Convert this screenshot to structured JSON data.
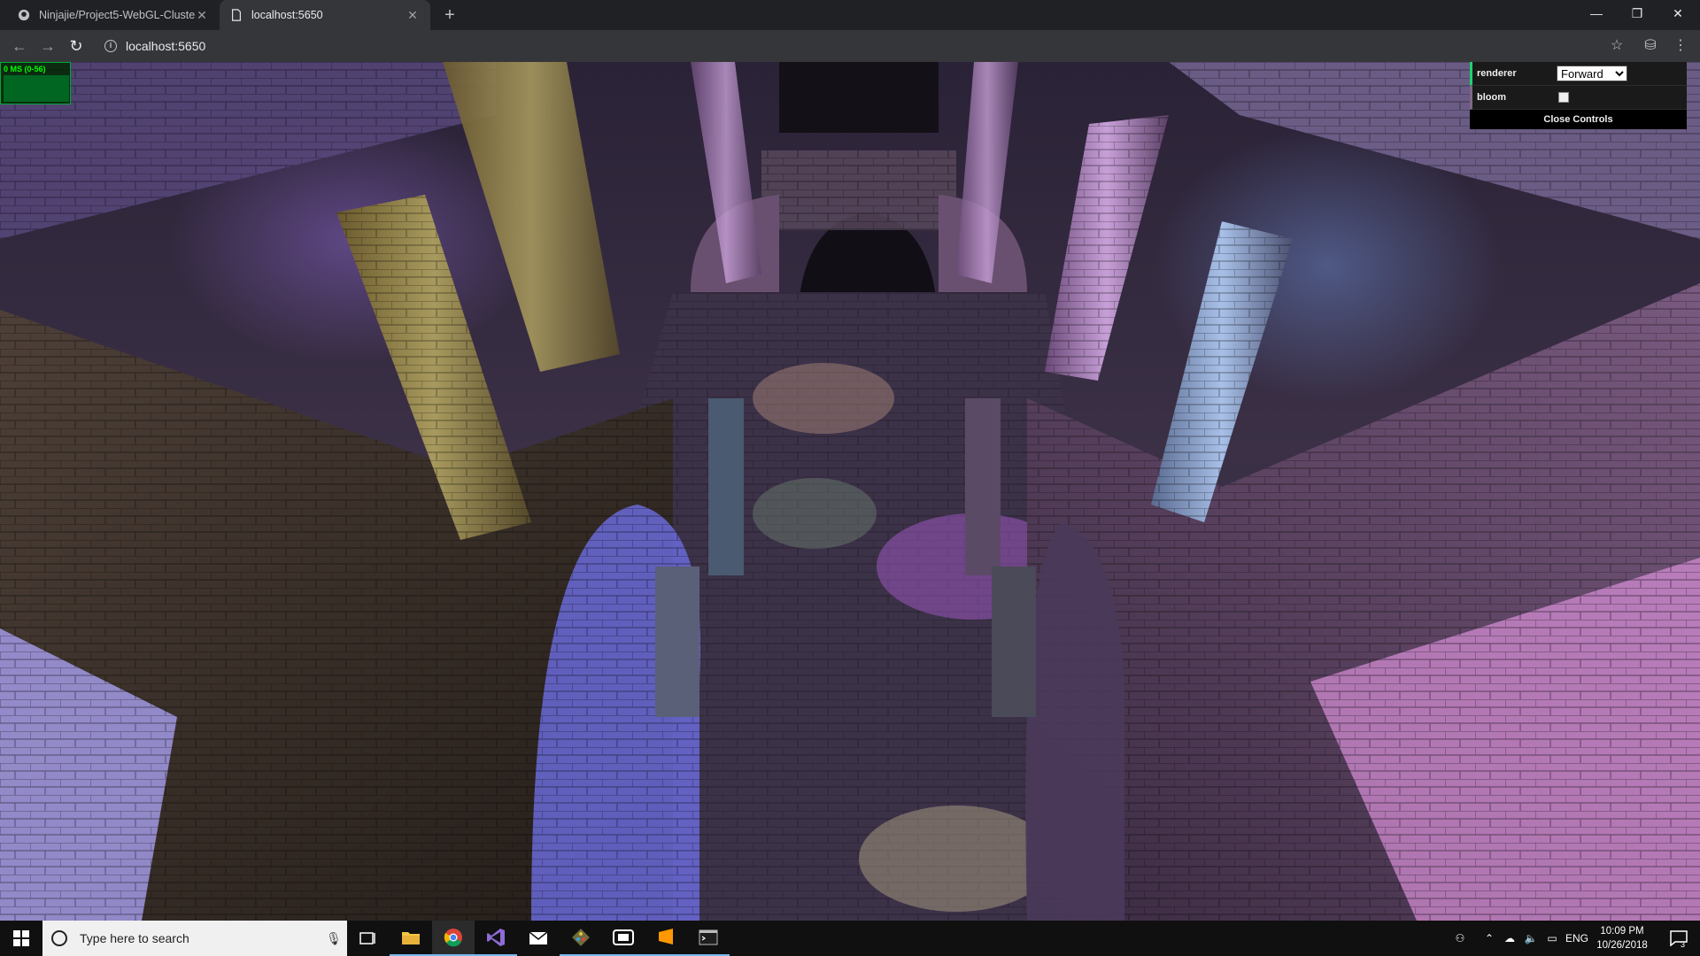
{
  "browser": {
    "tabs": [
      {
        "title": "Ninjajie/Project5-WebGL-Cluster",
        "active": false
      },
      {
        "title": "localhost:5650",
        "active": true
      }
    ],
    "address": "localhost:5650"
  },
  "stats": {
    "label": "0 MS (0-56)"
  },
  "gui": {
    "renderer_label": "renderer",
    "renderer_value": "Forward",
    "renderer_options": [
      "Forward"
    ],
    "bloom_label": "bloom",
    "bloom_checked": false,
    "close_label": "Close Controls"
  },
  "taskbar": {
    "search_placeholder": "Type here to search",
    "apps": [
      "task-view",
      "file-explorer",
      "chrome",
      "visual-studio",
      "mail",
      "git",
      "app-window",
      "sublime-text",
      "terminal"
    ],
    "language": "ENG",
    "time": "10:09 PM",
    "date": "10/26/2018",
    "notification_count": "3"
  },
  "colors": {
    "tabstrip": "#202124",
    "toolbar": "#35363a",
    "gui_accent": "#1ed36f",
    "taskbar": "#101010"
  }
}
